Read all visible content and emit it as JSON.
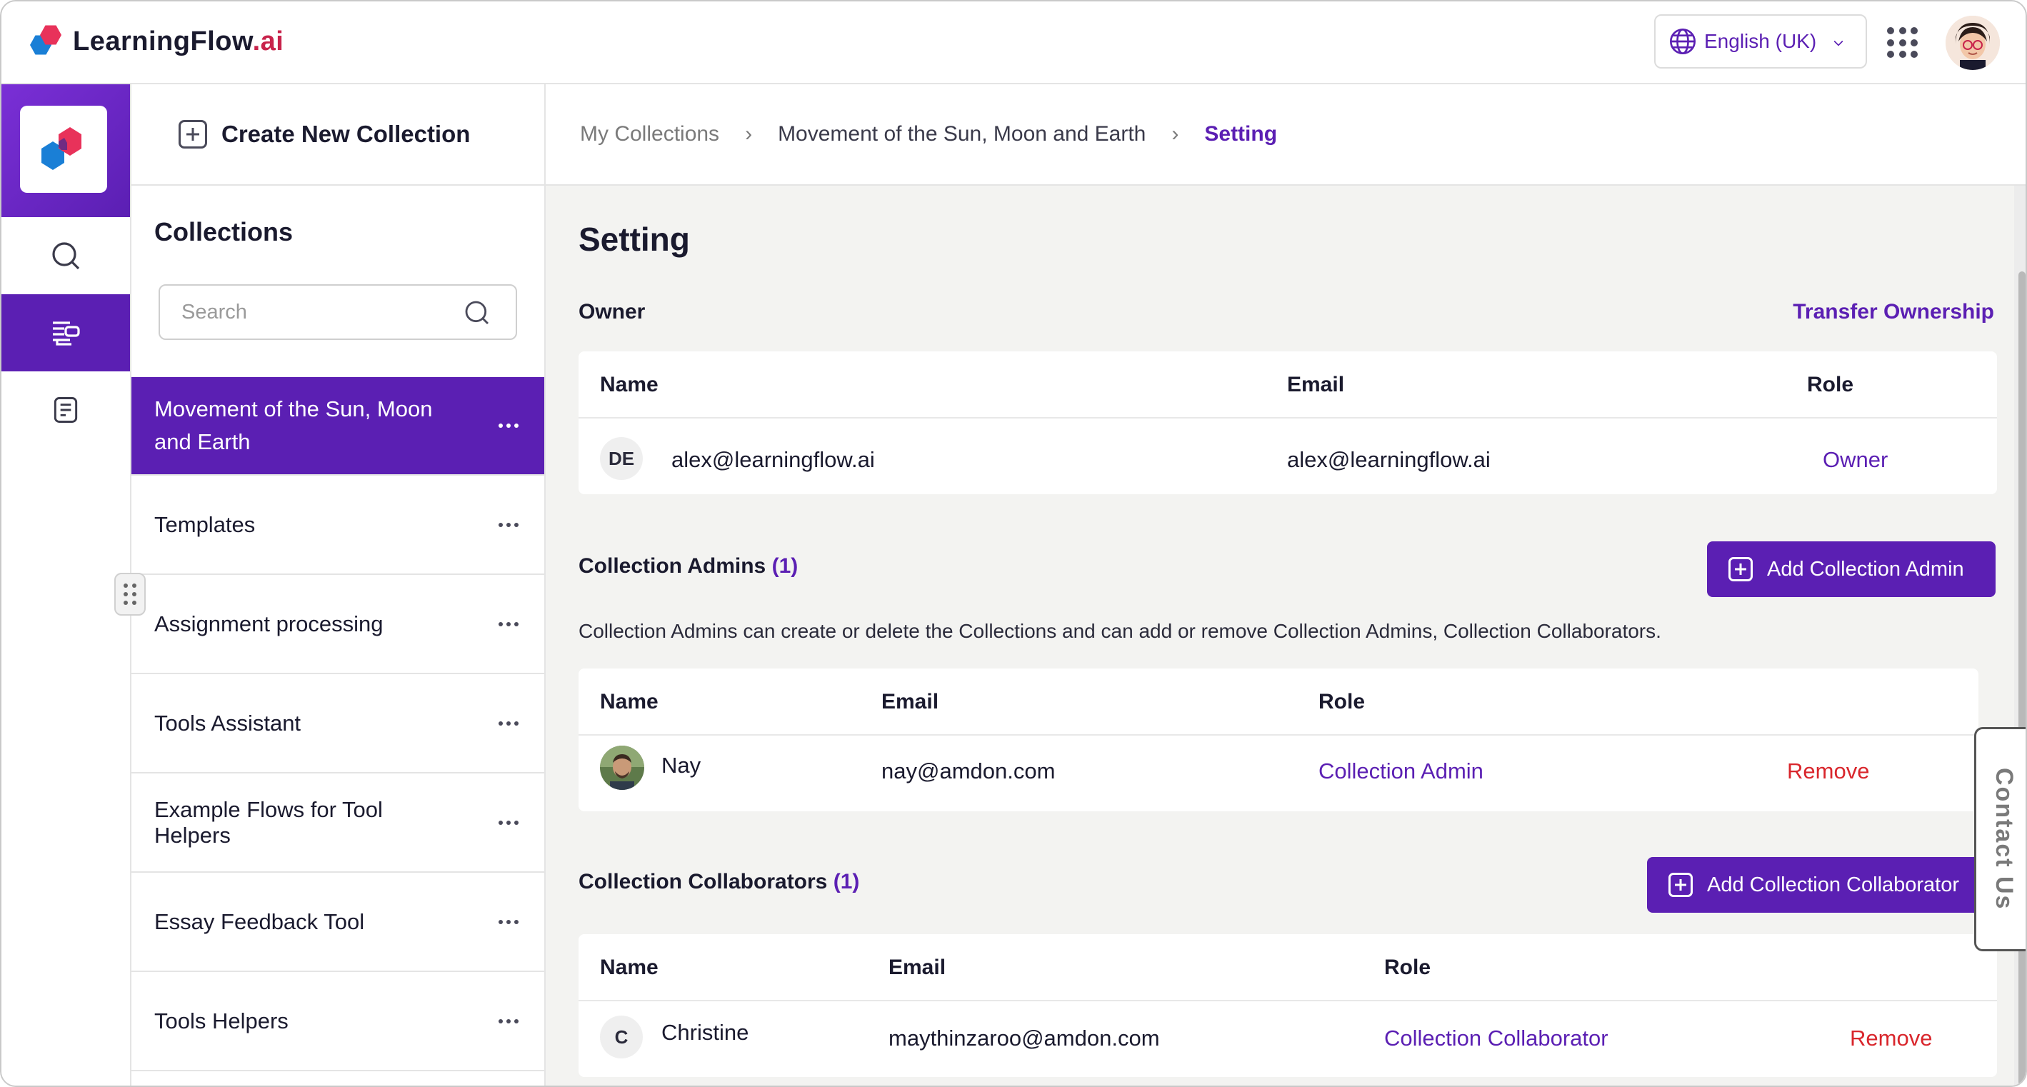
{
  "brand": {
    "name_main": "LearningFlow",
    "name_suffix": ".ai"
  },
  "header": {
    "language": "English (UK)"
  },
  "sidebar": {
    "create_label": "Create New Collection",
    "title": "Collections",
    "search_placeholder": "Search"
  },
  "collections": [
    "Movement of the Sun, Moon and Earth",
    "Templates",
    "Assignment processing",
    "Tools Assistant",
    "Example Flows for Tool Helpers",
    "Essay Feedback Tool",
    "Tools Helpers"
  ],
  "breadcrumb": {
    "root": "My Collections",
    "parent": "Movement of the Sun, Moon and Earth",
    "current": "Setting"
  },
  "page": {
    "title": "Setting"
  },
  "owner": {
    "heading": "Owner",
    "transfer_label": "Transfer Ownership",
    "headers": {
      "name": "Name",
      "email": "Email",
      "role": "Role"
    },
    "row": {
      "initials": "DE",
      "name": "alex@learningflow.ai",
      "email": "alex@learningflow.ai",
      "role": "Owner"
    }
  },
  "admins": {
    "heading": "Collection Admins",
    "count": "(1)",
    "add_label": "Add Collection Admin",
    "description": "Collection Admins can create or delete the Collections and can add or remove Collection Admins, Collection Collaborators.",
    "headers": {
      "name": "Name",
      "email": "Email",
      "role": "Role"
    },
    "row": {
      "name": "Nay",
      "email": "nay@amdon.com",
      "role": "Collection Admin",
      "action": "Remove"
    }
  },
  "collaborators": {
    "heading": "Collection Collaborators",
    "count": "(1)",
    "add_label": "Add Collection Collaborator",
    "headers": {
      "name": "Name",
      "email": "Email",
      "role": "Role"
    },
    "row": {
      "initials": "C",
      "name": "Christine",
      "email": "maythinzaroo@amdon.com",
      "role": "Collection Collaborator",
      "action": "Remove"
    }
  },
  "contact": {
    "label": "Contact Us"
  },
  "colors": {
    "primary": "#5b1fb3",
    "danger": "#d9262c",
    "brand_red": "#c8234b",
    "brand_blue": "#1a7fd6"
  }
}
